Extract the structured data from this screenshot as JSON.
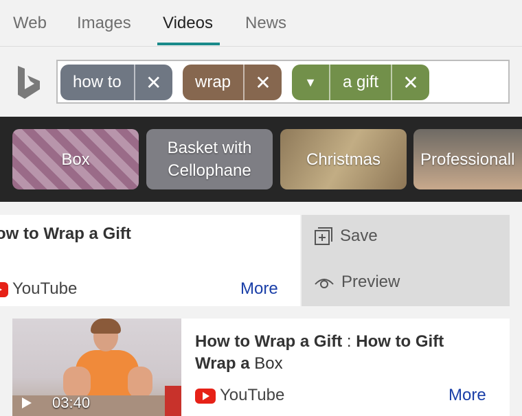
{
  "tabs": [
    {
      "label": "Web"
    },
    {
      "label": "Images"
    },
    {
      "label": "Videos"
    },
    {
      "label": "News"
    }
  ],
  "active_tab": "Videos",
  "search": {
    "chips": [
      {
        "label": "how to",
        "color": "#6f7783"
      },
      {
        "label": "wrap",
        "color": "#86674f"
      },
      {
        "label": "a gift",
        "color": "#72904a",
        "has_dropdown": true
      }
    ]
  },
  "filters": [
    {
      "label": "Box"
    },
    {
      "label": "Basket with Cellophane"
    },
    {
      "label": "Christmas"
    },
    {
      "label": "Professionall"
    }
  ],
  "results": [
    {
      "title": "ow to Wrap a Gift",
      "source": "YouTube",
      "more": "More",
      "actions": {
        "save": "Save",
        "preview": "Preview"
      }
    },
    {
      "title_part1": "How to Wrap a Gift",
      "title_sep": " : ",
      "title_part2": "How to Gift",
      "title_part3": "Wrap a",
      "title_part4": " Box",
      "duration": "03:40",
      "source": "YouTube",
      "more": "More"
    }
  ],
  "colors": {
    "accent": "#1a8a8a",
    "link": "#1a3fa8",
    "youtube": "#e62117"
  }
}
